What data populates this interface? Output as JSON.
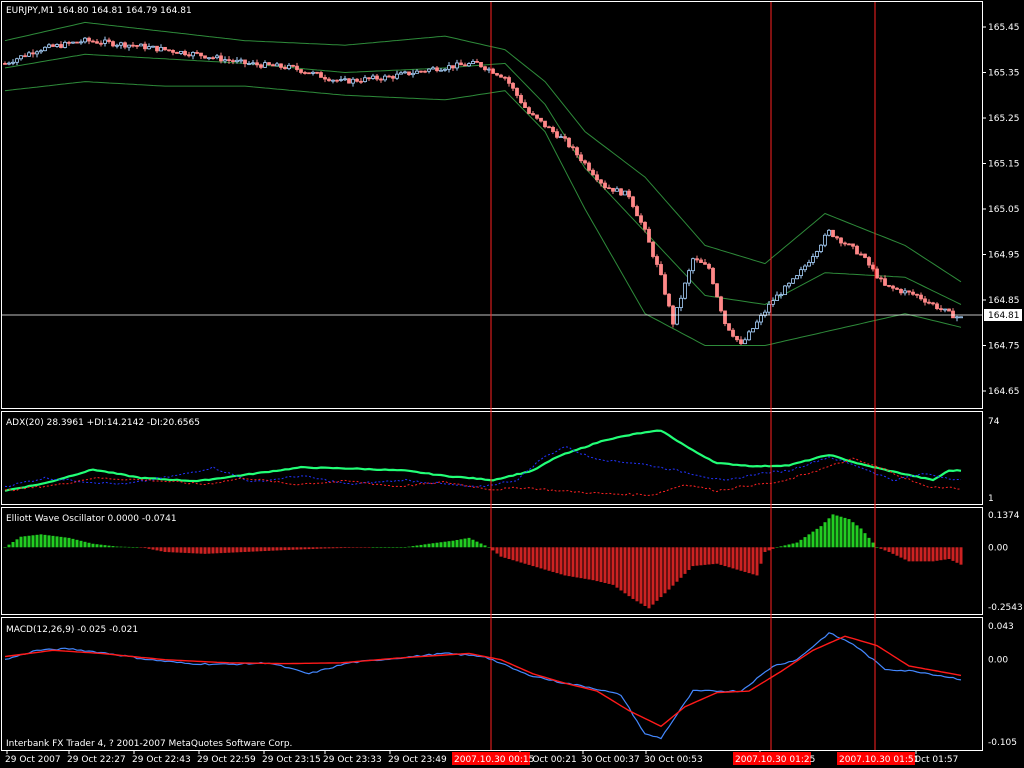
{
  "colors": {
    "background": "#000000",
    "frame": "#ffffff",
    "bull_candle": "#aad4ff",
    "bear_candle": "#ff8888",
    "bollinger": "#2e8b3a",
    "adx": "#22ff77",
    "plus_di": "#2233ff",
    "minus_di": "#ff2222",
    "ewo_positive": "#22cc22",
    "ewo_negative": "#cc2222",
    "macd_main": "#4488ff",
    "macd_signal": "#ff1a1a",
    "vline": "#ff2222",
    "price_line": "#ffffff",
    "time_marker_bg": "#ff0000"
  },
  "chart_data": [
    {
      "panel": "price",
      "type": "candlestick",
      "title": "EURJPY,M1  164.80 164.81 164.79 164.81",
      "ylim": [
        164.6,
        165.5
      ],
      "yticks": [
        "165.45",
        "165.35",
        "165.25",
        "165.15",
        "165.05",
        "164.95",
        "164.85",
        "164.75",
        "164.65"
      ],
      "current_price": "164.81",
      "close_keys": [
        [
          0,
          165.37
        ],
        [
          8,
          165.4
        ],
        [
          20,
          165.42
        ],
        [
          32,
          165.41
        ],
        [
          48,
          165.39
        ],
        [
          60,
          165.37
        ],
        [
          72,
          165.36
        ],
        [
          84,
          165.33
        ],
        [
          96,
          165.34
        ],
        [
          108,
          165.36
        ],
        [
          118,
          165.37
        ],
        [
          125,
          165.34
        ],
        [
          131,
          165.26
        ],
        [
          140,
          165.2
        ],
        [
          150,
          165.1
        ],
        [
          156,
          165.08
        ],
        [
          160,
          165.0
        ],
        [
          164,
          164.9
        ],
        [
          167,
          164.8
        ],
        [
          172,
          164.94
        ],
        [
          176,
          164.92
        ],
        [
          180,
          164.8
        ],
        [
          184,
          164.75
        ],
        [
          188,
          164.8
        ],
        [
          192,
          164.85
        ],
        [
          198,
          164.9
        ],
        [
          206,
          165.0
        ],
        [
          214,
          164.95
        ],
        [
          220,
          164.88
        ],
        [
          228,
          164.86
        ],
        [
          236,
          164.82
        ],
        [
          239,
          164.81
        ]
      ],
      "bollinger_upper": [
        [
          0,
          165.42
        ],
        [
          20,
          165.46
        ],
        [
          40,
          165.44
        ],
        [
          60,
          165.42
        ],
        [
          85,
          165.41
        ],
        [
          110,
          165.43
        ],
        [
          125,
          165.4
        ],
        [
          135,
          165.33
        ],
        [
          145,
          165.22
        ],
        [
          160,
          165.12
        ],
        [
          175,
          164.97
        ],
        [
          190,
          164.93
        ],
        [
          205,
          165.04
        ],
        [
          225,
          164.97
        ],
        [
          239,
          164.89
        ]
      ],
      "bollinger_middle": [
        [
          0,
          165.36
        ],
        [
          20,
          165.39
        ],
        [
          40,
          165.38
        ],
        [
          60,
          165.37
        ],
        [
          85,
          165.35
        ],
        [
          110,
          165.36
        ],
        [
          125,
          165.37
        ],
        [
          135,
          165.28
        ],
        [
          145,
          165.14
        ],
        [
          160,
          165.0
        ],
        [
          175,
          164.86
        ],
        [
          190,
          164.84
        ],
        [
          205,
          164.91
        ],
        [
          225,
          164.9
        ],
        [
          239,
          164.84
        ]
      ],
      "bollinger_lower": [
        [
          0,
          165.31
        ],
        [
          20,
          165.33
        ],
        [
          40,
          165.32
        ],
        [
          60,
          165.32
        ],
        [
          85,
          165.3
        ],
        [
          110,
          165.29
        ],
        [
          125,
          165.31
        ],
        [
          135,
          165.22
        ],
        [
          145,
          165.05
        ],
        [
          160,
          164.82
        ],
        [
          175,
          164.75
        ],
        [
          190,
          164.75
        ],
        [
          205,
          164.78
        ],
        [
          225,
          164.82
        ],
        [
          239,
          164.79
        ]
      ]
    },
    {
      "panel": "adx",
      "type": "line",
      "title": "ADX(20) 28.3961 +DI:14.2142 -DI:20.6565",
      "ylim": [
        1,
        74
      ],
      "yticks": [
        "74",
        "1"
      ],
      "series": [
        {
          "key": "adx",
          "values": [
            [
              0,
              8
            ],
            [
              10,
              15
            ],
            [
              22,
              28
            ],
            [
              34,
              20
            ],
            [
              48,
              17
            ],
            [
              62,
              24
            ],
            [
              74,
              30
            ],
            [
              86,
              29
            ],
            [
              100,
              27
            ],
            [
              110,
              22
            ],
            [
              122,
              18
            ],
            [
              132,
              27
            ],
            [
              138,
              40
            ],
            [
              150,
              56
            ],
            [
              158,
              62
            ],
            [
              164,
              65
            ],
            [
              172,
              46
            ],
            [
              178,
              34
            ],
            [
              188,
              31
            ],
            [
              196,
              32
            ],
            [
              206,
              42
            ],
            [
              214,
              33
            ],
            [
              222,
              26
            ],
            [
              232,
              18
            ],
            [
              236,
              27
            ],
            [
              239,
              27
            ]
          ]
        },
        {
          "key": "plus_di",
          "values": [
            [
              0,
              12
            ],
            [
              10,
              20
            ],
            [
              22,
              16
            ],
            [
              30,
              14
            ],
            [
              44,
              23
            ],
            [
              52,
              30
            ],
            [
              62,
              16
            ],
            [
              74,
              22
            ],
            [
              86,
              14
            ],
            [
              100,
              18
            ],
            [
              118,
              11
            ],
            [
              128,
              18
            ],
            [
              134,
              38
            ],
            [
              140,
              50
            ],
            [
              146,
              40
            ],
            [
              152,
              36
            ],
            [
              158,
              34
            ],
            [
              164,
              30
            ],
            [
              172,
              24
            ],
            [
              180,
              17
            ],
            [
              188,
              24
            ],
            [
              196,
              27
            ],
            [
              206,
              40
            ],
            [
              214,
              30
            ],
            [
              222,
              18
            ],
            [
              230,
              24
            ],
            [
              239,
              18
            ]
          ]
        },
        {
          "key": "minus_di",
          "values": [
            [
              0,
              8
            ],
            [
              14,
              14
            ],
            [
              22,
              20
            ],
            [
              36,
              18
            ],
            [
              50,
              14
            ],
            [
              60,
              20
            ],
            [
              72,
              14
            ],
            [
              86,
              17
            ],
            [
              98,
              12
            ],
            [
              110,
              16
            ],
            [
              122,
              9
            ],
            [
              130,
              11
            ],
            [
              138,
              8
            ],
            [
              150,
              5
            ],
            [
              162,
              4
            ],
            [
              170,
              14
            ],
            [
              178,
              8
            ],
            [
              186,
              13
            ],
            [
              194,
              16
            ],
            [
              202,
              26
            ],
            [
              212,
              38
            ],
            [
              220,
              28
            ],
            [
              230,
              12
            ],
            [
              239,
              10
            ]
          ]
        }
      ]
    },
    {
      "panel": "ewo",
      "type": "bar",
      "title": "Elliott Wave Oscillator 0.0000 -0.0741",
      "ylim": [
        -0.2543,
        0.1374
      ],
      "yticks": [
        "0.1374",
        "0.00",
        "-0.2543"
      ],
      "value_keys": [
        [
          0,
          0.0
        ],
        [
          4,
          0.045
        ],
        [
          9,
          0.055
        ],
        [
          16,
          0.04
        ],
        [
          22,
          0.015
        ],
        [
          28,
          0.003
        ],
        [
          34,
          0.0
        ],
        [
          40,
          -0.02
        ],
        [
          50,
          -0.028
        ],
        [
          60,
          -0.02
        ],
        [
          70,
          -0.012
        ],
        [
          80,
          -0.005
        ],
        [
          92,
          0.0
        ],
        [
          100,
          0.0
        ],
        [
          106,
          0.015
        ],
        [
          112,
          0.028
        ],
        [
          116,
          0.04
        ],
        [
          121,
          0.0
        ],
        [
          124,
          -0.04
        ],
        [
          132,
          -0.08
        ],
        [
          140,
          -0.12
        ],
        [
          147,
          -0.14
        ],
        [
          152,
          -0.16
        ],
        [
          157,
          -0.22
        ],
        [
          161,
          -0.26
        ],
        [
          166,
          -0.18
        ],
        [
          172,
          -0.08
        ],
        [
          178,
          -0.07
        ],
        [
          184,
          -0.1
        ],
        [
          188,
          -0.12
        ],
        [
          190,
          -0.02
        ],
        [
          193,
          0.0
        ],
        [
          198,
          0.02
        ],
        [
          204,
          0.09
        ],
        [
          207,
          0.14
        ],
        [
          211,
          0.12
        ],
        [
          214,
          0.08
        ],
        [
          218,
          0.0
        ],
        [
          221,
          -0.02
        ],
        [
          226,
          -0.06
        ],
        [
          232,
          -0.06
        ],
        [
          236,
          -0.05
        ],
        [
          239,
          -0.074
        ]
      ]
    },
    {
      "panel": "macd",
      "type": "line",
      "title": "MACD(12,26,9) -0.025 -0.021",
      "ylim": [
        -0.105,
        0.043
      ],
      "yticks": [
        "0.043",
        "0.00",
        "-0.105"
      ],
      "series": [
        {
          "key": "macd_main",
          "values": [
            [
              0,
              0.0
            ],
            [
              8,
              0.012
            ],
            [
              16,
              0.014
            ],
            [
              26,
              0.008
            ],
            [
              36,
              0.0
            ],
            [
              46,
              -0.005
            ],
            [
              56,
              -0.006
            ],
            [
              66,
              -0.004
            ],
            [
              76,
              -0.018
            ],
            [
              86,
              -0.004
            ],
            [
              98,
              0.002
            ],
            [
              110,
              0.008
            ],
            [
              120,
              0.004
            ],
            [
              130,
              -0.018
            ],
            [
              138,
              -0.028
            ],
            [
              146,
              -0.035
            ],
            [
              154,
              -0.045
            ],
            [
              160,
              -0.095
            ],
            [
              164,
              -0.1
            ],
            [
              172,
              -0.04
            ],
            [
              178,
              -0.04
            ],
            [
              184,
              -0.04
            ],
            [
              192,
              -0.008
            ],
            [
              198,
              0.0
            ],
            [
              206,
              0.034
            ],
            [
              212,
              0.02
            ],
            [
              220,
              -0.012
            ],
            [
              228,
              -0.015
            ],
            [
              239,
              -0.025
            ]
          ]
        },
        {
          "key": "macd_signal",
          "values": [
            [
              0,
              0.004
            ],
            [
              12,
              0.012
            ],
            [
              24,
              0.008
            ],
            [
              40,
              0.0
            ],
            [
              56,
              -0.004
            ],
            [
              70,
              -0.005
            ],
            [
              84,
              -0.004
            ],
            [
              98,
              0.002
            ],
            [
              116,
              0.008
            ],
            [
              124,
              0.0
            ],
            [
              132,
              -0.018
            ],
            [
              140,
              -0.03
            ],
            [
              148,
              -0.04
            ],
            [
              156,
              -0.065
            ],
            [
              164,
              -0.085
            ],
            [
              170,
              -0.06
            ],
            [
              178,
              -0.042
            ],
            [
              186,
              -0.04
            ],
            [
              194,
              -0.015
            ],
            [
              202,
              0.012
            ],
            [
              210,
              0.03
            ],
            [
              218,
              0.018
            ],
            [
              226,
              -0.008
            ],
            [
              239,
              -0.02
            ]
          ]
        }
      ]
    }
  ],
  "time_axis": {
    "labels": [
      "29 Oct 2007",
      "29 Oct 22:27",
      "29 Oct 22:43",
      "29 Oct 22:59",
      "29 Oct 23:15",
      "29 Oct 23:33",
      "29 Oct 23:49",
      "30 Oct 00:21",
      "30 Oct 00:37",
      "30 Oct 00:53",
      "25",
      "Oct 01:57"
    ],
    "markers": [
      "2007.10.30 00:15",
      "2007.10.30 01:25",
      "2007.10.30 01:51"
    ]
  },
  "footer": "Interbank FX Trader 4, ? 2001-2007 MetaQuotes Software Corp."
}
